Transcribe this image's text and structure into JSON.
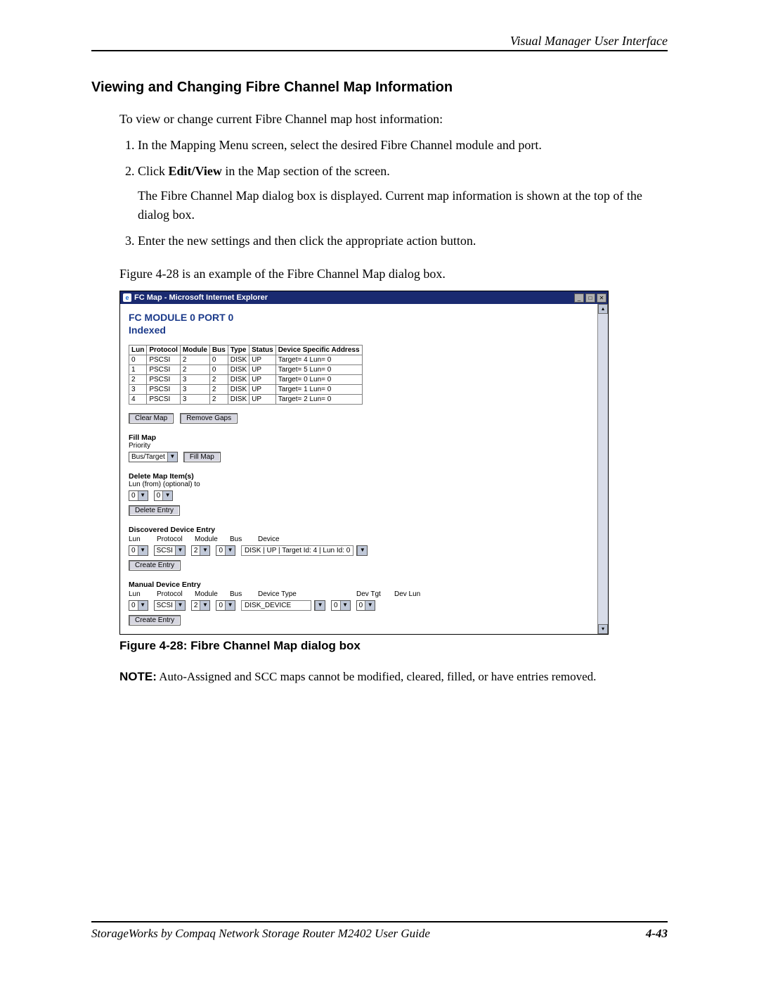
{
  "header": {
    "title": "Visual Manager User Interface"
  },
  "section": {
    "heading": "Viewing and Changing Fibre Channel Map Information"
  },
  "intro": "To view or change current Fibre Channel map host information:",
  "steps": {
    "s1": "In the Mapping Menu screen, select the desired Fibre Channel module and port.",
    "s2a": "Click ",
    "s2b_bold": "Edit/View",
    "s2c": " in the Map section of the screen.",
    "s2_sub": "The Fibre Channel Map dialog box is displayed. Current map information is shown at the top of the dialog box.",
    "s3": "Enter the new settings and then click the appropriate action button."
  },
  "fig_intro": "Figure 4-28 is an example of the Fibre Channel Map dialog box.",
  "figure_caption_prefix": "Figure 4-28:  ",
  "figure_caption_text": "Fibre Channel Map dialog box",
  "note_label": "NOTE:",
  "note_text": "  Auto-Assigned and SCC maps cannot be modified, cleared, filled, or have entries removed.",
  "footer": {
    "left": "StorageWorks by Compaq Network Storage Router M2402 User Guide",
    "right": "4-43"
  },
  "ie": {
    "title": "FC Map - Microsoft Internet Explorer",
    "fc_title_line1": "FC MODULE 0 PORT 0",
    "fc_title_line2": "Indexed",
    "table_headers": {
      "lun": "Lun",
      "protocol": "Protocol",
      "module": "Module",
      "bus": "Bus",
      "type": "Type",
      "status": "Status",
      "dsa": "Device Specific Address"
    },
    "rows": [
      {
        "lun": "0",
        "protocol": "PSCSI",
        "module": "2",
        "bus": "0",
        "type": "DISK",
        "status": "UP",
        "dsa": "Target= 4 Lun= 0"
      },
      {
        "lun": "1",
        "protocol": "PSCSI",
        "module": "2",
        "bus": "0",
        "type": "DISK",
        "status": "UP",
        "dsa": "Target= 5 Lun= 0"
      },
      {
        "lun": "2",
        "protocol": "PSCSI",
        "module": "3",
        "bus": "2",
        "type": "DISK",
        "status": "UP",
        "dsa": "Target= 0 Lun= 0"
      },
      {
        "lun": "3",
        "protocol": "PSCSI",
        "module": "3",
        "bus": "2",
        "type": "DISK",
        "status": "UP",
        "dsa": "Target= 1 Lun= 0"
      },
      {
        "lun": "4",
        "protocol": "PSCSI",
        "module": "3",
        "bus": "2",
        "type": "DISK",
        "status": "UP",
        "dsa": "Target= 2 Lun= 0"
      }
    ],
    "btn_clear_map": "Clear Map",
    "btn_remove_gaps": "Remove Gaps",
    "fill_map_head": "Fill Map",
    "fill_map_priority_label": "Priority",
    "fill_map_dd": "Bus/Target",
    "btn_fill_map": "Fill Map",
    "delete_head": "Delete Map Item(s)",
    "delete_sub": "Lun (from) (optional) to",
    "delete_from": "0",
    "delete_to": "0",
    "btn_delete_entry": "Delete Entry",
    "disc_head": "Discovered Device Entry",
    "disc_cols": {
      "lun": "Lun",
      "protocol": "Protocol",
      "module": "Module",
      "bus": "Bus",
      "device": "Device"
    },
    "disc_vals": {
      "lun": "0",
      "protocol": "SCSI",
      "module": "2",
      "bus": "0",
      "device_info": "DISK | UP | Target Id:  4 | Lun Id:  0"
    },
    "btn_create_entry1": "Create Entry",
    "man_head": "Manual Device Entry",
    "man_cols": {
      "lun": "Lun",
      "protocol": "Protocol",
      "module": "Module",
      "bus": "Bus",
      "device_type": "Device Type",
      "dev_tgt": "Dev Tgt",
      "dev_lun": "Dev Lun"
    },
    "man_vals": {
      "lun": "0",
      "protocol": "SCSI",
      "module": "2",
      "bus": "0",
      "device_type": "DISK_DEVICE",
      "dev_tgt": "0",
      "dev_lun": "0"
    },
    "btn_create_entry2": "Create Entry"
  }
}
